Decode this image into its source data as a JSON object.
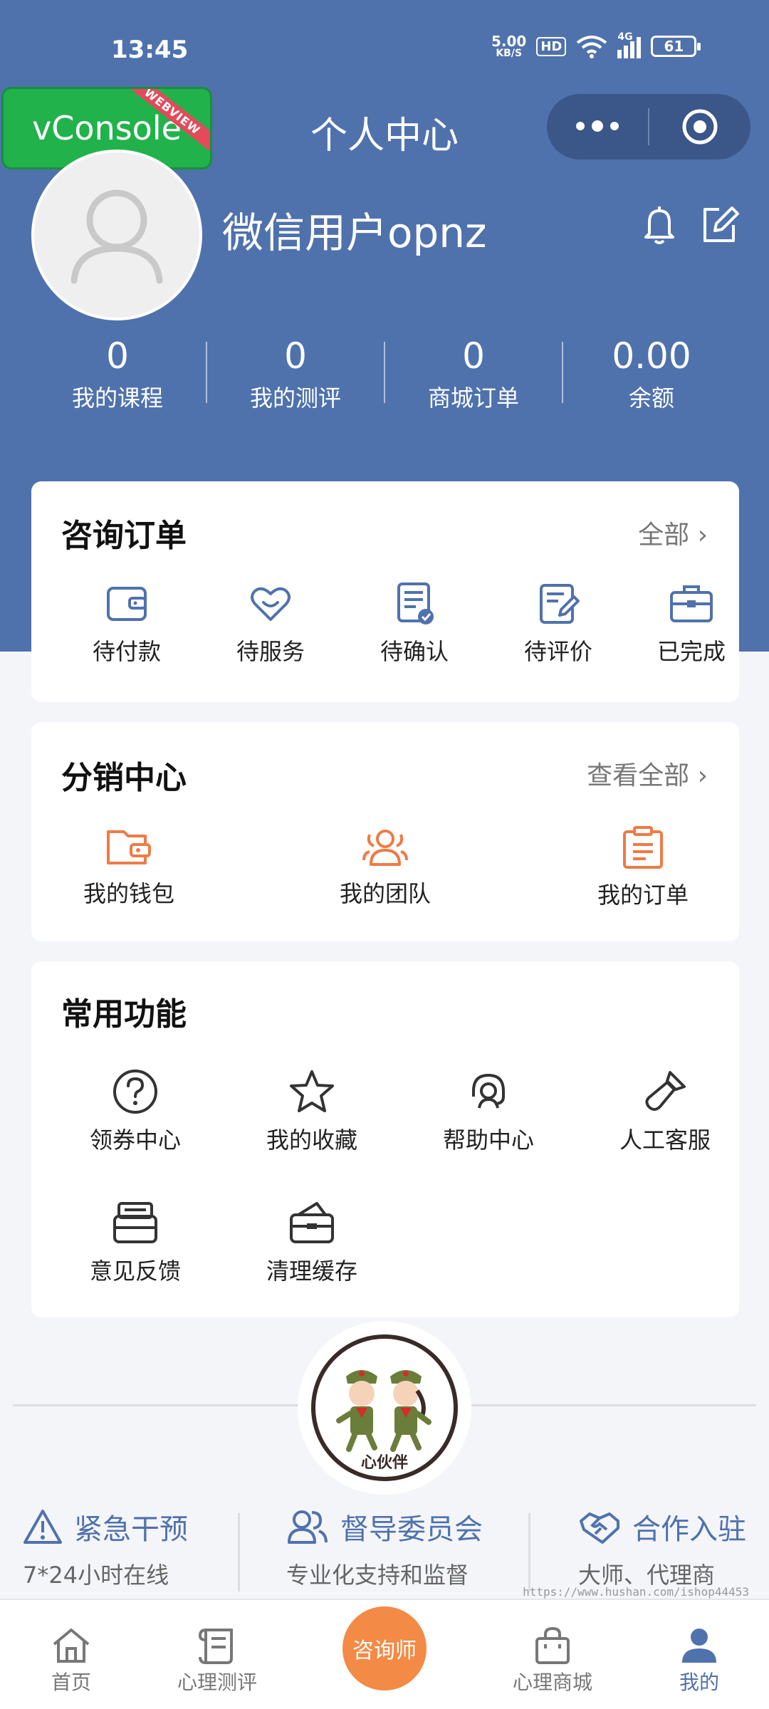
{
  "status_bar": {
    "time": "13:45",
    "net_speed_value": "5.00",
    "net_speed_unit": "KB/S",
    "hd": "HD",
    "network": "4G",
    "battery": "61"
  },
  "nav": {
    "vconsole": "vConsole",
    "ribbon": "WEBVIEW",
    "title": "个人中心"
  },
  "profile": {
    "username": "微信用户opnz"
  },
  "stats": [
    {
      "value": "0",
      "label": "我的课程"
    },
    {
      "value": "0",
      "label": "我的测评"
    },
    {
      "value": "0",
      "label": "商城订单"
    },
    {
      "value": "0.00",
      "label": "余额"
    }
  ],
  "consult_orders": {
    "title": "咨询订单",
    "more": "全部",
    "items": [
      {
        "label": "待付款",
        "icon": "wallet-icon"
      },
      {
        "label": "待服务",
        "icon": "heart-icon"
      },
      {
        "label": "待确认",
        "icon": "checklist-icon"
      },
      {
        "label": "待评价",
        "icon": "edit-document-icon"
      },
      {
        "label": "已完成",
        "icon": "briefcase-icon"
      }
    ]
  },
  "distribution": {
    "title": "分销中心",
    "more": "查看全部",
    "items": [
      {
        "label": "我的钱包",
        "icon": "wallet-icon"
      },
      {
        "label": "我的团队",
        "icon": "team-icon"
      },
      {
        "label": "我的订单",
        "icon": "clipboard-icon"
      }
    ]
  },
  "functions": {
    "title": "常用功能",
    "items": [
      {
        "label": "领券中心",
        "icon": "question-icon"
      },
      {
        "label": "我的收藏",
        "icon": "star-icon"
      },
      {
        "label": "帮助中心",
        "icon": "headset-icon"
      },
      {
        "label": "人工客服",
        "icon": "brush-icon"
      },
      {
        "label": "意见反馈",
        "icon": "printer-icon"
      },
      {
        "label": "清理缓存",
        "icon": "cache-icon"
      }
    ]
  },
  "logo": {
    "text": "心伙伴"
  },
  "features": [
    {
      "title": "紧急干预",
      "subtitle": "7*24小时在线",
      "icon": "warning-icon"
    },
    {
      "title": "督导委员会",
      "subtitle": "专业化支持和监督",
      "icon": "people-icon"
    },
    {
      "title": "合作入驻",
      "subtitle": "大师、代理商",
      "icon": "handshake-icon"
    }
  ],
  "watermark": "https://www.hushan.com/ishop44453",
  "tabbar": {
    "items": [
      {
        "label": "首页",
        "icon": "home-icon"
      },
      {
        "label": "心理测评",
        "icon": "scroll-icon"
      },
      {
        "label": "咨询师",
        "icon": "counselor-button"
      },
      {
        "label": "心理商城",
        "icon": "shopping-bag-icon"
      },
      {
        "label": "我的",
        "icon": "user-icon"
      }
    ],
    "active": "我的"
  },
  "colors": {
    "primary": "#4f72ad",
    "accent_orange": "#ee7b45",
    "vconsole_green": "#22b24c",
    "background": "#f4f5f9"
  }
}
